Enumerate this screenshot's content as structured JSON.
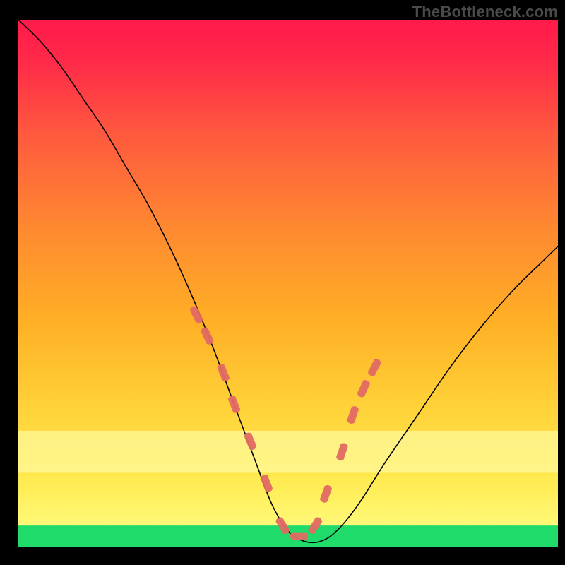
{
  "watermark": "TheBottleneck.com",
  "colors": {
    "gradient_top": "#ff1a4b",
    "gradient_mid": "#ffb125",
    "gradient_low": "#ffe84b",
    "band_yellow": "#fff68f",
    "band_green": "#1fdc6a",
    "curve": "#000000",
    "marker": "#e26a63",
    "frame": "#000000"
  },
  "chart_data": {
    "type": "line",
    "title": "",
    "xlabel": "",
    "ylabel": "",
    "xlim": [
      0,
      100
    ],
    "ylim": [
      0,
      100
    ],
    "note": "Axes are unlabeled in the source image; values are normalized 0–100 read off pixel positions. y=0 is the bottom green band, y=100 is the top.",
    "series": [
      {
        "name": "bottleneck-curve",
        "x": [
          0,
          4,
          8,
          12,
          16,
          20,
          24,
          28,
          32,
          36,
          40,
          44,
          47,
          50,
          53,
          56,
          59,
          63,
          68,
          74,
          80,
          86,
          92,
          97,
          100
        ],
        "y": [
          100,
          96,
          91,
          85,
          79,
          72,
          65,
          57,
          48,
          38,
          27,
          16,
          8,
          3,
          1,
          1,
          3,
          8,
          16,
          25,
          34,
          42,
          49,
          54,
          57
        ]
      }
    ],
    "bands": [
      {
        "name": "pale-yellow",
        "y_from": 14,
        "y_to": 22
      },
      {
        "name": "green",
        "y_from": 0,
        "y_to": 4
      }
    ],
    "markers": {
      "name": "highlighted-points",
      "note": "Salmon lozenges drawn on the curve near its minimum and on both ascending flanks.",
      "x": [
        33,
        35,
        38,
        40,
        43,
        46,
        49,
        52,
        55,
        57,
        60,
        62,
        64,
        66
      ],
      "y": [
        44,
        40,
        33,
        27,
        20,
        12,
        4,
        2,
        4,
        10,
        18,
        25,
        30,
        34
      ]
    }
  }
}
